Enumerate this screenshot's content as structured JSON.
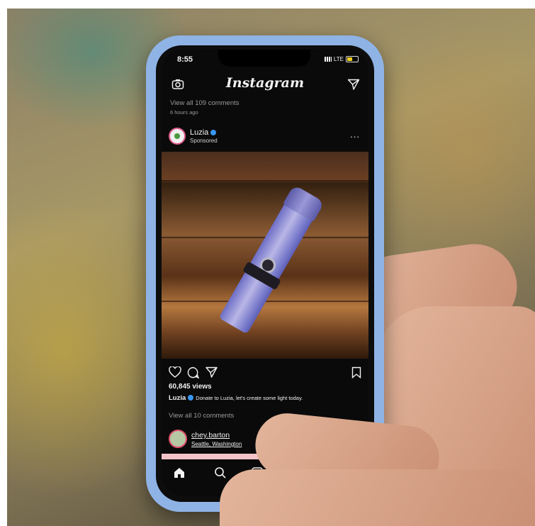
{
  "status_bar": {
    "time": "8:55",
    "network": "LTE"
  },
  "header": {
    "logo": "Instagram",
    "camera_icon": "camera-icon",
    "direct_icon": "paper-plane-icon"
  },
  "previous_post": {
    "comments_link": "View all 109 comments",
    "timestamp": "6 hours ago"
  },
  "post": {
    "username": "Luzia",
    "sponsored_label": "Sponsored",
    "more_label": "...",
    "media_alt": "flashlight on wooden surface",
    "action_icons": [
      "heart-icon",
      "comment-icon",
      "share-icon",
      "bookmark-icon"
    ],
    "views": "60,845 views",
    "caption_user": "Luzia",
    "caption_text": "Donate to Luzia, let's create some light today.",
    "comments_link": "View all 10 comments"
  },
  "next_post": {
    "username": "chey.barton",
    "location": "Seattle, Washington"
  },
  "tab_bar": {
    "icons": [
      "home-icon",
      "search-icon",
      "add-icon",
      "heart-icon",
      "profile-icon"
    ]
  },
  "colors": {
    "phone_case": "#8fb3e5",
    "verified_badge": "#3897f0",
    "story_ring": "#e05a8a"
  }
}
